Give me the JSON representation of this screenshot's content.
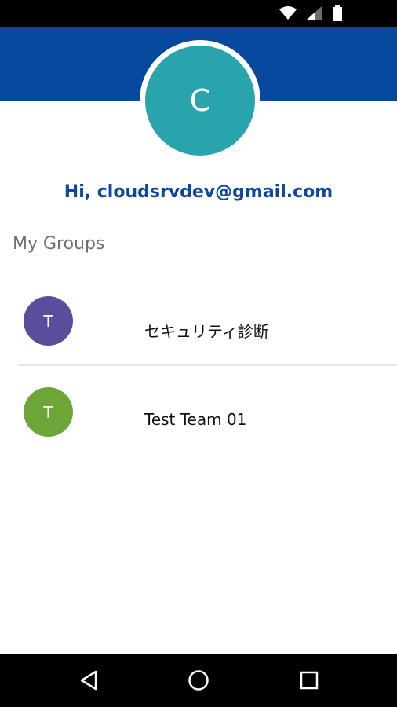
{
  "status_bar": {
    "icons": [
      "wifi-icon",
      "cell-signal-icon",
      "battery-icon"
    ]
  },
  "profile": {
    "avatar_initial": "C",
    "avatar_color": "#29a3ac",
    "greeting": "Hi, cloudsrvdev@gmail.com"
  },
  "groups": {
    "title": "My Groups",
    "items": [
      {
        "initial": "T",
        "name": "セキュリティ診断",
        "color": "#5a4e9c"
      },
      {
        "initial": "T",
        "name": "Test Team 01",
        "color": "#6ea539"
      }
    ]
  },
  "nav_bar": {
    "icons": [
      "back-icon",
      "home-icon",
      "recents-icon"
    ]
  },
  "colors": {
    "header": "#06489e",
    "greeting_text": "#0d47a1"
  }
}
